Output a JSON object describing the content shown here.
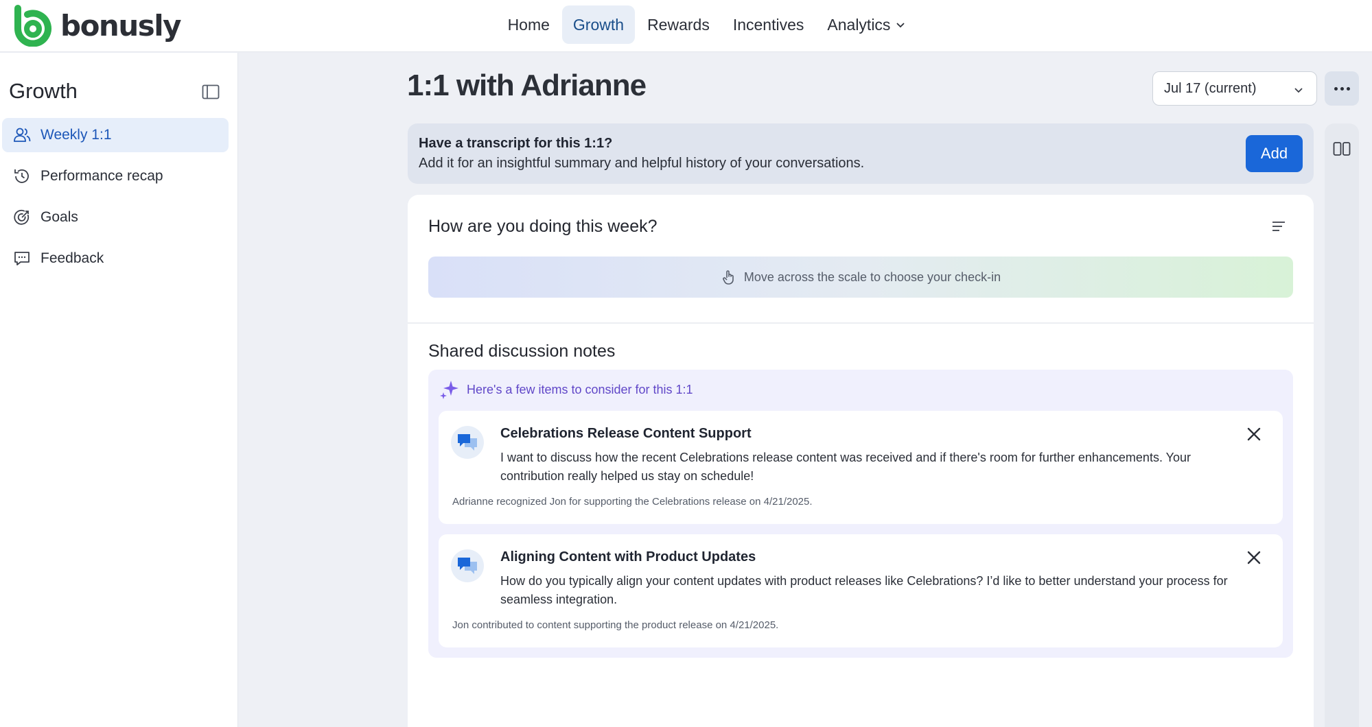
{
  "brand": {
    "name": "bonusly",
    "color": "#2fb350"
  },
  "nav": {
    "items": [
      {
        "label": "Home",
        "active": false
      },
      {
        "label": "Growth",
        "active": true
      },
      {
        "label": "Rewards",
        "active": false
      },
      {
        "label": "Incentives",
        "active": false
      },
      {
        "label": "Analytics",
        "active": false,
        "has_dropdown": true
      }
    ]
  },
  "sidebar": {
    "title": "Growth",
    "items": [
      {
        "label": "Weekly 1:1",
        "icon": "users-icon",
        "active": true
      },
      {
        "label": "Performance recap",
        "icon": "history-icon",
        "active": false
      },
      {
        "label": "Goals",
        "icon": "target-icon",
        "active": false
      },
      {
        "label": "Feedback",
        "icon": "chat-icon",
        "active": false
      }
    ]
  },
  "main": {
    "title": "1:1 with Adrianne",
    "date_select": "Jul 17 (current)",
    "transcript": {
      "title": "Have a transcript for this 1:1?",
      "subtitle": "Add it for an insightful summary and helpful history of your conversations.",
      "button": "Add"
    },
    "checkin": {
      "title": "How are you doing this week?",
      "scale_hint": "Move across the scale to choose your check-in"
    },
    "notes": {
      "title": "Shared discussion notes",
      "suggest_heading": "Here's a few items to consider for this 1:1",
      "items": [
        {
          "title": "Celebrations Release Content Support",
          "body": "I want to discuss how the recent Celebrations release content was received and if there's room for further enhancements. Your contribution really helped us stay on schedule!",
          "footnote": "Adrianne recognized Jon for supporting the Celebrations release on 4/21/2025."
        },
        {
          "title": "Aligning Content with Product Updates",
          "body": "How do you typically align your content updates with product releases like Celebrations? I’d like to better understand your process for seamless integration.",
          "footnote": "Jon contributed to content supporting the product release on 4/21/2025."
        }
      ]
    }
  },
  "colors": {
    "accent": "#1a67d9",
    "nav_active_bg": "#e8eef7",
    "sidebar_active_bg": "#e6eefa",
    "suggest_bg": "#f0f0fd",
    "suggest_text": "#6047c8"
  }
}
